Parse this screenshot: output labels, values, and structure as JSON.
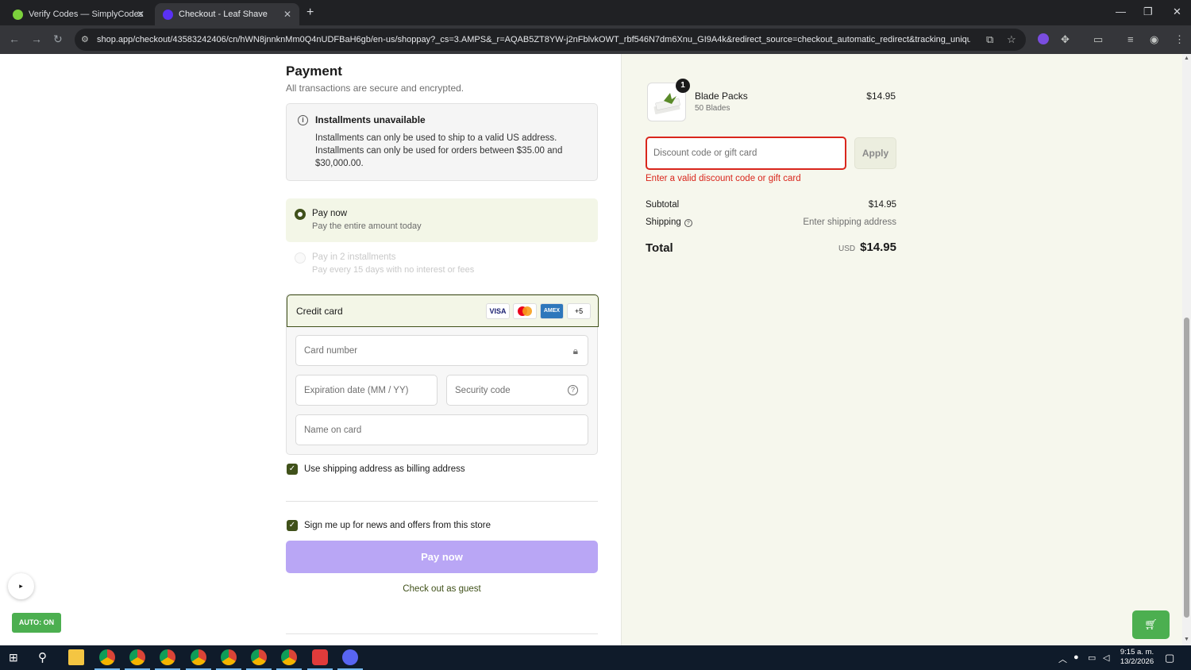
{
  "browser": {
    "tabs": [
      {
        "title": "Verify Codes — SimplyCodes",
        "active": false
      },
      {
        "title": "Checkout - Leaf Shave",
        "active": true
      }
    ],
    "url": "shop.app/checkout/43583242406/cn/hWN8jnnknMm0Q4nUDFBaH6gb/en-us/shoppay?_cs=3.AMPS&_r=AQAB5ZT8YW-j2nFblvkOWT_rbf546N7dm6Xnu_GI9A4k&redirect_source=checkout_automatic_redirect&tracking_unique=f..."
  },
  "payment": {
    "title": "Payment",
    "subtitle": "All transactions are secure and encrypted.",
    "notice": {
      "title": "Installments unavailable",
      "line1": "Installments can only be used to ship to a valid US address.",
      "line2": "Installments can only be used for orders between $35.00 and",
      "line3": "$30,000.00."
    },
    "options": [
      {
        "label": "Pay now",
        "sub": "Pay the entire amount today",
        "selected": true
      },
      {
        "label": "Pay in 2 installments",
        "sub": "Pay every 15 days with no interest or fees",
        "selected": false
      }
    ],
    "credit_card": {
      "label": "Credit card",
      "logos": [
        "VISA",
        "",
        "AMEX",
        "+5"
      ],
      "card_number_placeholder": "Card number",
      "expiry_placeholder": "Expiration date (MM / YY)",
      "security_placeholder": "Security code",
      "name_placeholder": "Name on card"
    },
    "billing_same": "Use shipping address as billing address",
    "newsletter": "Sign me up for news and offers from this store",
    "pay_button": "Pay now",
    "guest_link": "Check out as guest"
  },
  "summary": {
    "item": {
      "qty": "1",
      "name": "Blade Packs",
      "variant": "50 Blades",
      "price": "$14.95"
    },
    "discount_placeholder": "Discount code or gift card",
    "apply_label": "Apply",
    "error": "Enter a valid discount code or gift card",
    "subtotal_label": "Subtotal",
    "subtotal_value": "$14.95",
    "shipping_label": "Shipping",
    "shipping_value": "Enter shipping address",
    "total_label": "Total",
    "total_currency": "USD",
    "total_value": "$14.95"
  },
  "overlays": {
    "auto_label": "AUTO: ON",
    "play_icon": "▸"
  },
  "taskbar": {
    "time": "9:15 a. m.",
    "date": "13/2/2026"
  },
  "colors": {
    "accent": "#40511a",
    "error": "#d9261c",
    "pay_button": "#b9a6f5",
    "summary_bg": "#f6f7ed"
  }
}
